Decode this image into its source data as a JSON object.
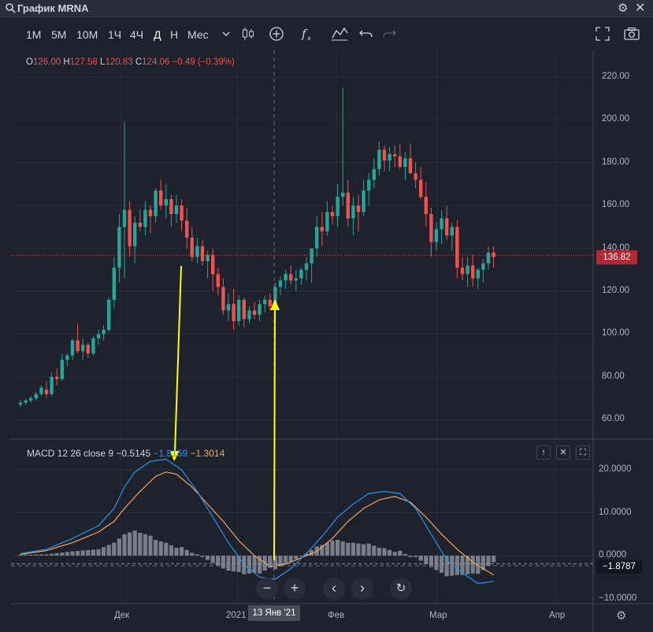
{
  "window": {
    "title": "График MRNA"
  },
  "toolbar": {
    "timeframes": [
      "1M",
      "5M",
      "10M",
      "1Ч",
      "4Ч",
      "Д",
      "Н",
      "Мес"
    ],
    "active": "Д"
  },
  "ohlc": {
    "o_label": "O",
    "o": "126.00",
    "h_label": "H",
    "h": "127.58",
    "l_label": "L",
    "l": "120.83",
    "c_label": "C",
    "c": "124.06",
    "chg": "−0.49 (−0.39%)"
  },
  "price_axis": [
    "220.00",
    "200.00",
    "180.00",
    "160.00",
    "140.00",
    "120.00",
    "100.00",
    "80.00",
    "60.00"
  ],
  "last_price": "136.82",
  "macd": {
    "label": "MACD 12 26 close 9",
    "hist": "−0.5145",
    "macd": "−1.8159",
    "signal": "−1.3014",
    "axis": [
      "20.0000",
      "10.0000",
      "0.0000",
      "−10.0000"
    ],
    "last": "−1.8787"
  },
  "time_axis": [
    "Дек",
    "2021",
    "Фев",
    "Мар",
    "Апр"
  ],
  "crosshair_date": "13 Янв '21",
  "colors": {
    "up": "#26a69a",
    "down": "#ef5350",
    "macd": "#2196f3",
    "signal": "#f7a35c",
    "arrow": "#ffff00"
  },
  "chart_data": {
    "type": "candlestick",
    "price_ylim": [
      55,
      228
    ],
    "macd_ylim": [
      -10,
      25
    ],
    "candles": [
      [
        0,
        67,
        69,
        66,
        68
      ],
      [
        1,
        68,
        70,
        67,
        69
      ],
      [
        2,
        69,
        71,
        68,
        70
      ],
      [
        3,
        70,
        73,
        69,
        72
      ],
      [
        4,
        72,
        76,
        71,
        75
      ],
      [
        5,
        74,
        78,
        70,
        72
      ],
      [
        6,
        72,
        82,
        71,
        80
      ],
      [
        7,
        80,
        84,
        76,
        79
      ],
      [
        8,
        79,
        91,
        78,
        88
      ],
      [
        9,
        88,
        91,
        85,
        90
      ],
      [
        10,
        90,
        98,
        88,
        97
      ],
      [
        11,
        97,
        105,
        91,
        92
      ],
      [
        12,
        92,
        98,
        88,
        95
      ],
      [
        13,
        95,
        96,
        89,
        91
      ],
      [
        14,
        91,
        99,
        90,
        98
      ],
      [
        15,
        98,
        102,
        95,
        100
      ],
      [
        16,
        100,
        104,
        97,
        102
      ],
      [
        17,
        102,
        117,
        101,
        116
      ],
      [
        18,
        116,
        136,
        112,
        131
      ],
      [
        19,
        131,
        156,
        124,
        150
      ],
      [
        20,
        150,
        199,
        126,
        158
      ],
      [
        21,
        158,
        162,
        136,
        141
      ],
      [
        22,
        141,
        155,
        133,
        152
      ],
      [
        23,
        152,
        158,
        148,
        150
      ],
      [
        24,
        150,
        162,
        146,
        158
      ],
      [
        25,
        158,
        160,
        147,
        155
      ],
      [
        26,
        155,
        168,
        152,
        167
      ],
      [
        27,
        167,
        172,
        158,
        160
      ],
      [
        28,
        160,
        170,
        154,
        163
      ],
      [
        29,
        163,
        165,
        150,
        156
      ],
      [
        30,
        156,
        165,
        152,
        160
      ],
      [
        31,
        160,
        163,
        148,
        153
      ],
      [
        32,
        153,
        159,
        140,
        145
      ],
      [
        33,
        145,
        150,
        134,
        136
      ],
      [
        34,
        136,
        145,
        133,
        141
      ],
      [
        35,
        141,
        144,
        132,
        134
      ],
      [
        36,
        134,
        139,
        126,
        137
      ],
      [
        37,
        137,
        140,
        120,
        128
      ],
      [
        38,
        128,
        131,
        118,
        122
      ],
      [
        39,
        122,
        126,
        109,
        111
      ],
      [
        40,
        111,
        119,
        106,
        114
      ],
      [
        41,
        114,
        121,
        102,
        106
      ],
      [
        42,
        106,
        118,
        104,
        116
      ],
      [
        43,
        116,
        117,
        103,
        107
      ],
      [
        44,
        107,
        113,
        105,
        111
      ],
      [
        45,
        111,
        115,
        107,
        109
      ],
      [
        46,
        109,
        116,
        106,
        114
      ],
      [
        47,
        114,
        118,
        110,
        116
      ],
      [
        48,
        116,
        119,
        111,
        113
      ],
      [
        49,
        113,
        124,
        111,
        122
      ],
      [
        50,
        122,
        127,
        118,
        125
      ],
      [
        51,
        125,
        130,
        121,
        128
      ],
      [
        52,
        128,
        132,
        123,
        125
      ],
      [
        53,
        125,
        130,
        120,
        126
      ],
      [
        54,
        126,
        131,
        123,
        130
      ],
      [
        55,
        130,
        136,
        125,
        133
      ],
      [
        56,
        133,
        138,
        124,
        140
      ],
      [
        57,
        140,
        155,
        136,
        150
      ],
      [
        58,
        150,
        157,
        141,
        148
      ],
      [
        59,
        148,
        162,
        146,
        157
      ],
      [
        60,
        157,
        160,
        151,
        155
      ],
      [
        61,
        155,
        170,
        150,
        164
      ],
      [
        62,
        164,
        215,
        160,
        166
      ],
      [
        63,
        166,
        172,
        150,
        154
      ],
      [
        64,
        154,
        164,
        146,
        160
      ],
      [
        65,
        160,
        165,
        148,
        157
      ],
      [
        66,
        157,
        172,
        155,
        167
      ],
      [
        67,
        167,
        175,
        160,
        172
      ],
      [
        68,
        172,
        182,
        168,
        177
      ],
      [
        69,
        177,
        190,
        174,
        186
      ],
      [
        70,
        186,
        188,
        176,
        181
      ],
      [
        71,
        181,
        187,
        176,
        184
      ],
      [
        72,
        184,
        188,
        178,
        183
      ],
      [
        73,
        183,
        189,
        177,
        178
      ],
      [
        74,
        178,
        185,
        172,
        182
      ],
      [
        75,
        182,
        189,
        175,
        175
      ],
      [
        76,
        175,
        180,
        168,
        172
      ],
      [
        77,
        172,
        178,
        163,
        164
      ],
      [
        78,
        164,
        171,
        150,
        156
      ],
      [
        79,
        156,
        159,
        136,
        143
      ],
      [
        80,
        143,
        152,
        139,
        149
      ],
      [
        81,
        149,
        158,
        142,
        154
      ],
      [
        82,
        154,
        160,
        144,
        146
      ],
      [
        83,
        146,
        152,
        139,
        150
      ],
      [
        84,
        150,
        153,
        126,
        131
      ],
      [
        85,
        131,
        136,
        125,
        128
      ],
      [
        86,
        128,
        136,
        122,
        132
      ],
      [
        87,
        132,
        137,
        122,
        126
      ],
      [
        88,
        126,
        131,
        121,
        130
      ],
      [
        89,
        130,
        135,
        124,
        133
      ],
      [
        90,
        133,
        141,
        130,
        138
      ],
      [
        91,
        138,
        141,
        131,
        136
      ]
    ],
    "macd_line": [
      [
        0,
        0.5
      ],
      [
        5,
        1.5
      ],
      [
        10,
        4
      ],
      [
        15,
        7
      ],
      [
        18,
        11
      ],
      [
        20,
        16
      ],
      [
        22,
        19.5
      ],
      [
        25,
        22
      ],
      [
        28,
        22.5
      ],
      [
        31,
        20
      ],
      [
        34,
        15
      ],
      [
        37,
        9
      ],
      [
        40,
        3
      ],
      [
        43,
        -2
      ],
      [
        46,
        -5
      ],
      [
        49,
        -5.5
      ],
      [
        52,
        -3
      ],
      [
        55,
        0.5
      ],
      [
        58,
        4.5
      ],
      [
        61,
        9
      ],
      [
        64,
        12
      ],
      [
        67,
        14.5
      ],
      [
        70,
        15
      ],
      [
        73,
        14.5
      ],
      [
        76,
        11
      ],
      [
        79,
        5
      ],
      [
        82,
        -1
      ],
      [
        85,
        -4
      ],
      [
        88,
        -6.5
      ],
      [
        91,
        -6
      ]
    ],
    "signal_line": [
      [
        0,
        0.3
      ],
      [
        5,
        1.2
      ],
      [
        10,
        3
      ],
      [
        15,
        5.5
      ],
      [
        18,
        8
      ],
      [
        20,
        11
      ],
      [
        23,
        15
      ],
      [
        26,
        18.5
      ],
      [
        28,
        19.5
      ],
      [
        30,
        19
      ],
      [
        33,
        16
      ],
      [
        36,
        12
      ],
      [
        39,
        8
      ],
      [
        42,
        3.5
      ],
      [
        45,
        0
      ],
      [
        48,
        -2.5
      ],
      [
        51,
        -2
      ],
      [
        54,
        -0.5
      ],
      [
        57,
        1
      ],
      [
        60,
        4
      ],
      [
        63,
        8
      ],
      [
        66,
        11
      ],
      [
        69,
        13
      ],
      [
        72,
        13.8
      ],
      [
        75,
        12.5
      ],
      [
        78,
        9
      ],
      [
        81,
        5
      ],
      [
        84,
        1.5
      ],
      [
        87,
        -1.5
      ],
      [
        91,
        -4.5
      ]
    ]
  }
}
